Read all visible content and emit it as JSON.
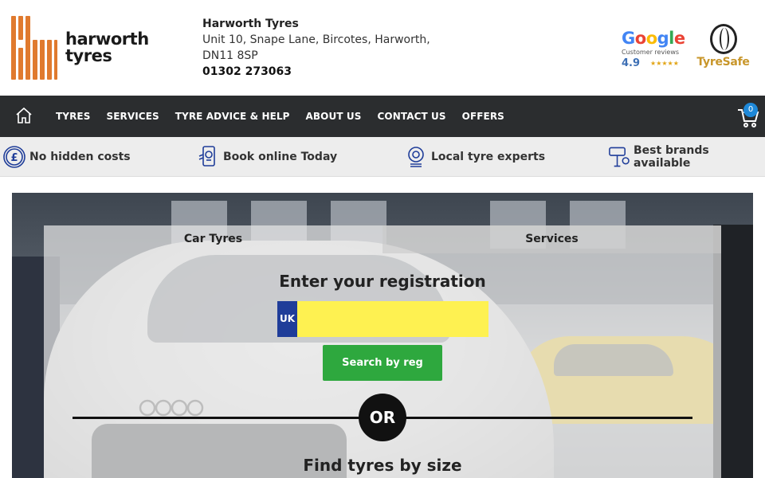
{
  "header": {
    "logo_line1": "harworth",
    "logo_line2": "tyres",
    "company": "Harworth Tyres",
    "address_line1": "Unit 10, Snape Lane, Bircotes, Harworth,",
    "address_line2": "DN11 8SP",
    "phone": "01302 273063",
    "google": {
      "word": "Google",
      "subtitle": "Customer reviews",
      "rating": "4.9",
      "stars": "★★★★★"
    },
    "tyresafe": "TyreSafe"
  },
  "nav": {
    "items": [
      "TYRES",
      "SERVICES",
      "TYRE ADVICE & HELP",
      "ABOUT US",
      "CONTACT US",
      "OFFERS"
    ],
    "cart_count": "0"
  },
  "usp": {
    "items": [
      "No hidden costs",
      "Book online Today",
      "Local tyre experts",
      "Best brands available"
    ]
  },
  "search": {
    "tabs": [
      "Car Tyres",
      "Services"
    ],
    "reg_title": "Enter your registration",
    "reg_prefix": "UK",
    "reg_value": "",
    "reg_placeholder": "",
    "search_button": "Search by reg",
    "or_label": "OR",
    "size_title": "Find tyres by size"
  },
  "colors": {
    "brand_orange": "#e07a2e",
    "nav_bg": "#2b2d2f",
    "reg_yellow": "#fef151",
    "reg_blue": "#1f3d99",
    "button_green": "#2ea83e",
    "cart_badge": "#1e88d8"
  }
}
